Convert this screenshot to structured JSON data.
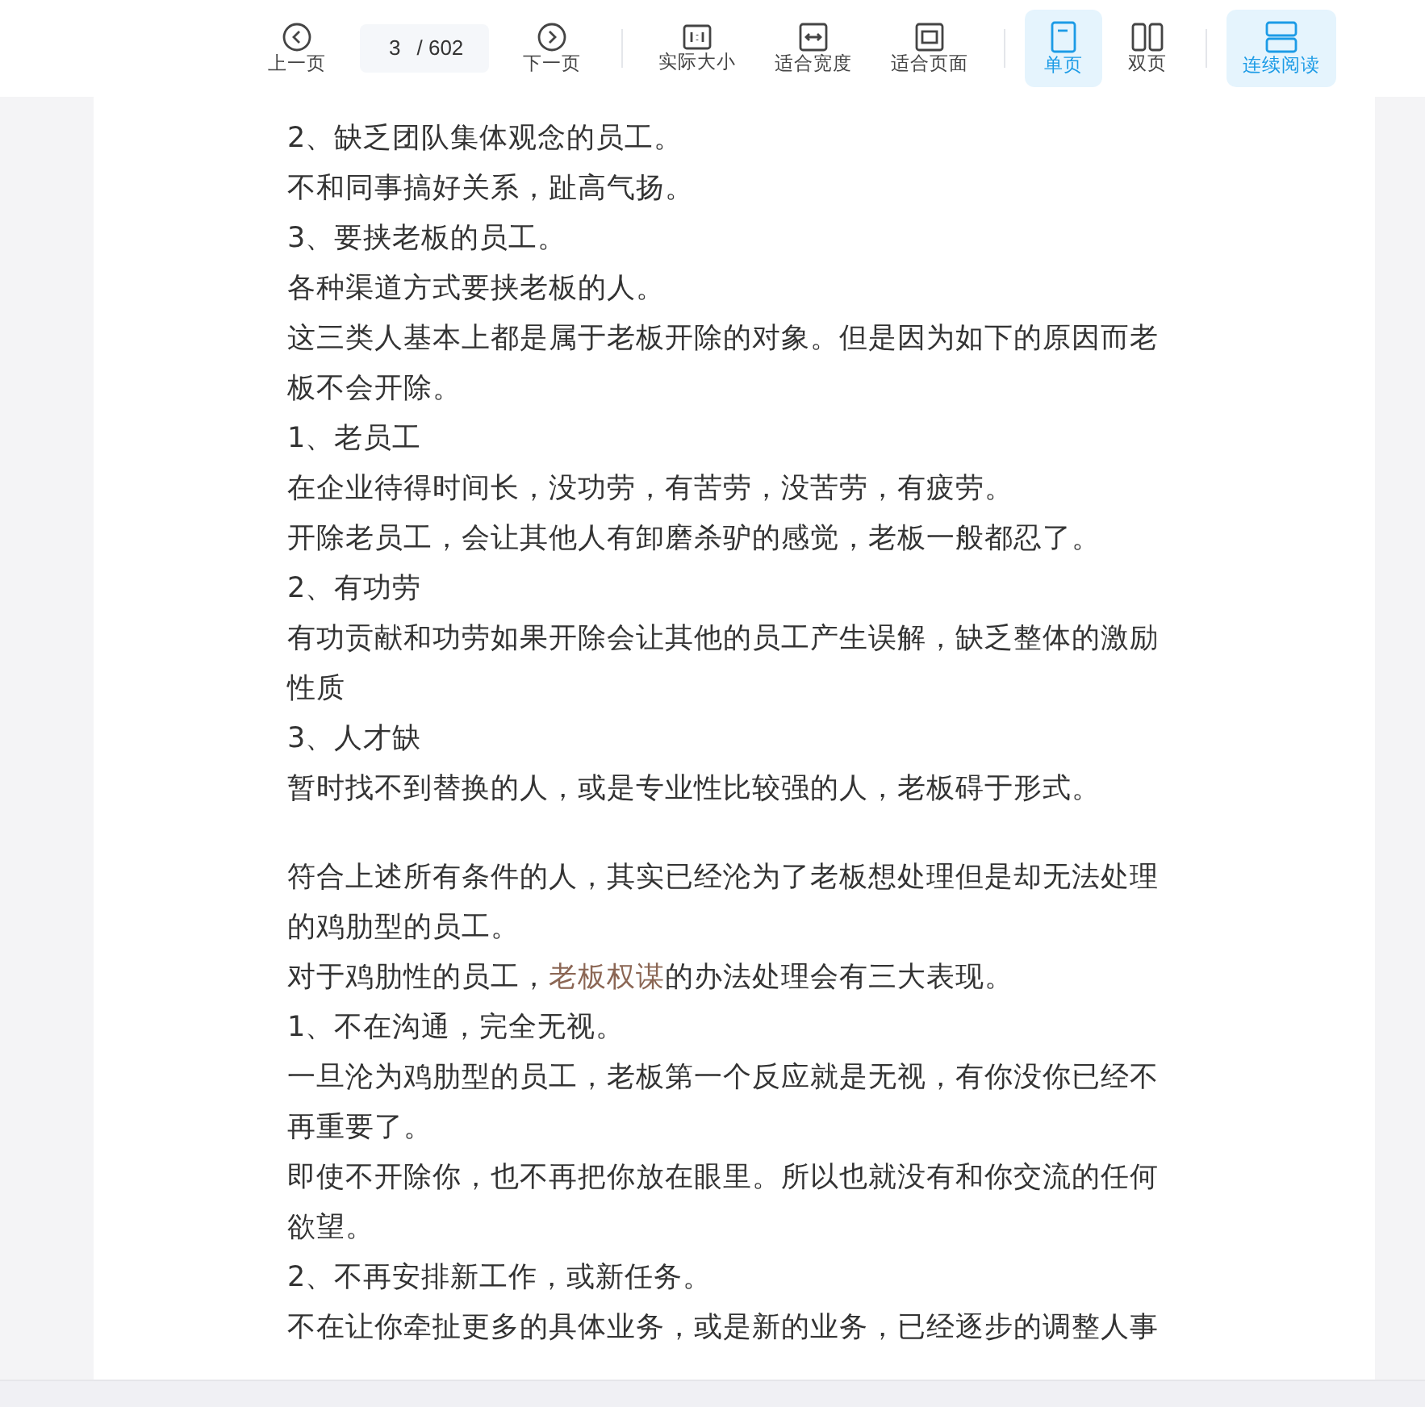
{
  "toolbar": {
    "items": [
      {
        "kind": "prev",
        "label": "上一页",
        "selected": false
      },
      {
        "kind": "page",
        "current": "3",
        "total": "/ 602"
      },
      {
        "kind": "next",
        "label": "下一页",
        "selected": false
      },
      {
        "kind": "divider"
      },
      {
        "kind": "actual",
        "label": "实际大小",
        "selected": false
      },
      {
        "kind": "fitwidth",
        "label": "适合宽度",
        "selected": false
      },
      {
        "kind": "fitpage",
        "label": "适合页面",
        "selected": false
      },
      {
        "kind": "divider"
      },
      {
        "kind": "single",
        "label": "单页",
        "selected": true
      },
      {
        "kind": "double",
        "label": "双页",
        "selected": false
      },
      {
        "kind": "divider"
      },
      {
        "kind": "continuous",
        "label": "连续阅读",
        "selected": true
      }
    ]
  },
  "document": {
    "paragraphs": [
      {
        "parts": [
          {
            "text": "2、缺乏团队集体观念的员工。"
          }
        ]
      },
      {
        "parts": [
          {
            "text": "不和同事搞好关系，趾高气扬。"
          }
        ]
      },
      {
        "parts": [
          {
            "text": "3、要挟老板的员工。"
          }
        ]
      },
      {
        "parts": [
          {
            "text": "各种渠道方式要挟老板的人。"
          }
        ]
      },
      {
        "parts": [
          {
            "text": "这三类人基本上都是属于老板开除的对象。但是因为如下的原因而老板不会开除。"
          }
        ]
      },
      {
        "parts": [
          {
            "text": "1、老员工"
          }
        ]
      },
      {
        "parts": [
          {
            "text": "在企业待得时间长，没功劳，有苦劳，没苦劳，有疲劳。"
          }
        ]
      },
      {
        "parts": [
          {
            "text": "开除老员工，会让其他人有卸磨杀驴的感觉，老板一般都忍了。"
          }
        ]
      },
      {
        "parts": [
          {
            "text": "2、有功劳"
          }
        ]
      },
      {
        "parts": [
          {
            "text": "有功贡献和功劳如果开除会让其他的员工产生误解，缺乏整体的激励性质"
          }
        ]
      },
      {
        "parts": [
          {
            "text": "3、人才缺"
          }
        ]
      },
      {
        "parts": [
          {
            "text": "暂时找不到替换的人，或是专业性比较强的人，老板碍于形式。"
          }
        ]
      },
      {
        "space_before": true,
        "parts": [
          {
            "text": "符合上述所有条件的人，其实已经沦为了老板想处理但是却无法处理的鸡肋型的员工。"
          }
        ]
      },
      {
        "parts": [
          {
            "text": "对于鸡肋性的员工，"
          },
          {
            "text": "老板权谋",
            "kind": "link"
          },
          {
            "text": "的办法处理会有三大表现。"
          }
        ]
      },
      {
        "parts": [
          {
            "text": "1、不在沟通，完全无视。"
          }
        ]
      },
      {
        "parts": [
          {
            "text": "一旦沦为鸡肋型的员工，老板第一个反应就是无视，有你没你已经不再重要了。"
          }
        ]
      },
      {
        "parts": [
          {
            "text": "即使不开除你，也不再把你放在眼里。所以也就没有和你交流的任何欲望。"
          }
        ]
      },
      {
        "parts": [
          {
            "text": "2、不再安排新工作，或新任务。"
          }
        ]
      },
      {
        "parts": [
          {
            "text": "不在让你牵扯更多的具体业务，或是新的业务，已经逐步的调整人事"
          }
        ]
      }
    ]
  }
}
